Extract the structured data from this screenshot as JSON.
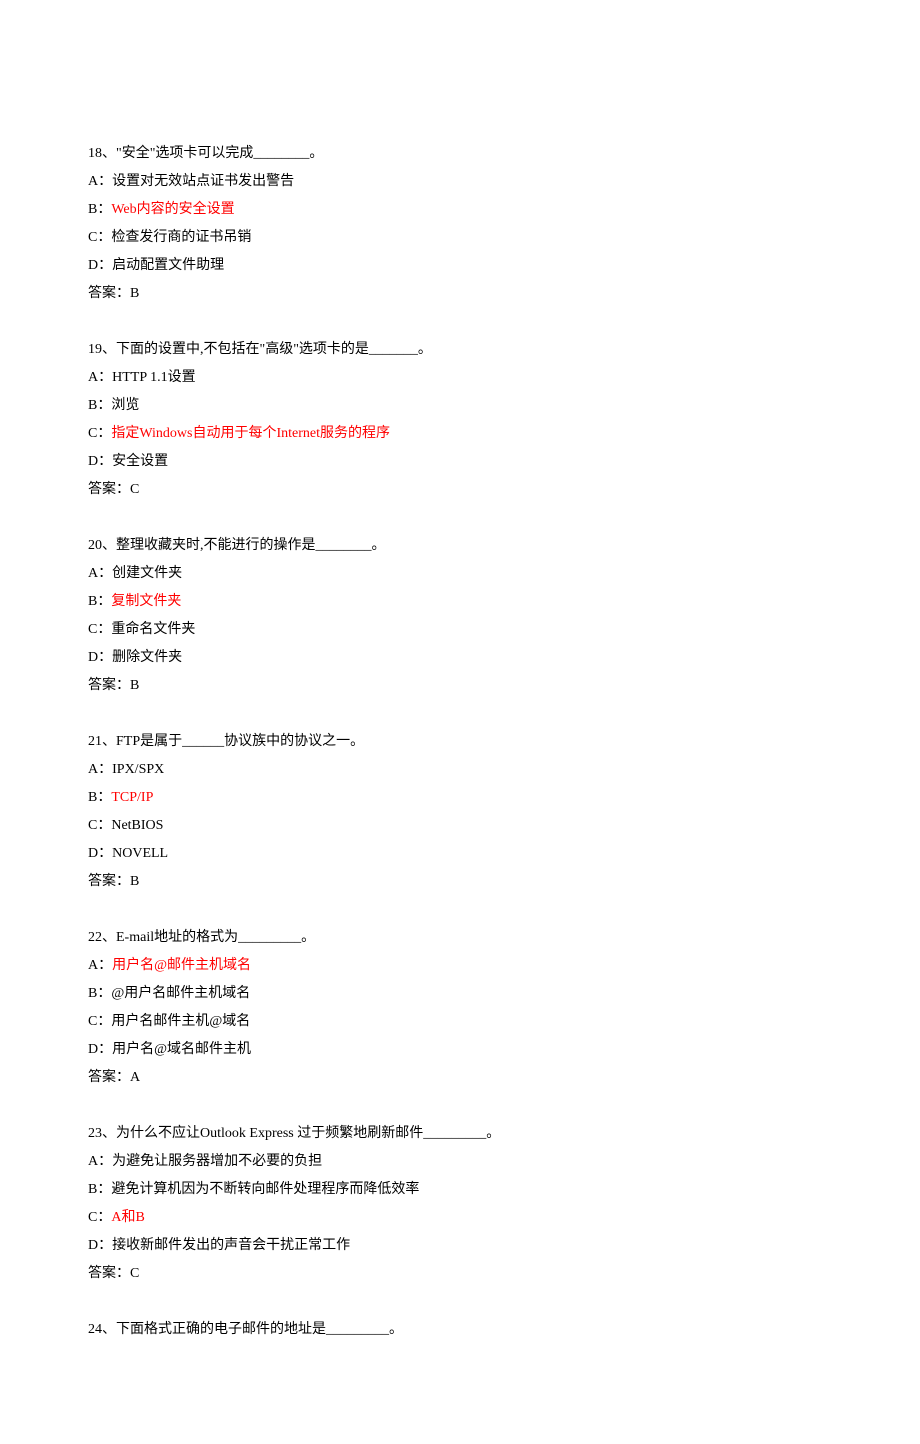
{
  "questions": [
    {
      "id": "q18",
      "stem": "18、\"安全\"选项卡可以完成________。",
      "options": [
        {
          "id": "q18A",
          "label": "A：",
          "text": "设置对无效站点证书发出警告",
          "highlight": false
        },
        {
          "id": "q18B",
          "label": "B：",
          "text": "Web内容的安全设置",
          "highlight": true
        },
        {
          "id": "q18C",
          "label": "C：",
          "text": "检查发行商的证书吊销",
          "highlight": false
        },
        {
          "id": "q18D",
          "label": "D：",
          "text": "启动配置文件助理",
          "highlight": false
        }
      ],
      "answer": "答案：B"
    },
    {
      "id": "q19",
      "stem": "19、下面的设置中,不包括在\"高级\"选项卡的是_______。",
      "options": [
        {
          "id": "q19A",
          "label": "A：",
          "text": "HTTP 1.1设置",
          "highlight": false
        },
        {
          "id": "q19B",
          "label": "B：",
          "text": "浏览",
          "highlight": false
        },
        {
          "id": "q19C",
          "label": "C：",
          "text": "指定Windows自动用于每个Internet服务的程序",
          "highlight": true
        },
        {
          "id": "q19D",
          "label": "D：",
          "text": "安全设置",
          "highlight": false
        }
      ],
      "answer": "答案：C"
    },
    {
      "id": "q20",
      "stem": "20、整理收藏夹时,不能进行的操作是________。",
      "options": [
        {
          "id": "q20A",
          "label": "A：",
          "text": "创建文件夹",
          "highlight": false
        },
        {
          "id": "q20B",
          "label": "B：",
          "text": "复制文件夹",
          "highlight": true
        },
        {
          "id": "q20C",
          "label": "C：",
          "text": "重命名文件夹",
          "highlight": false
        },
        {
          "id": "q20D",
          "label": "D：",
          "text": "删除文件夹",
          "highlight": false
        }
      ],
      "answer": "答案：B"
    },
    {
      "id": "q21",
      "stem": "21、FTP是属于______协议族中的协议之一。",
      "options": [
        {
          "id": "q21A",
          "label": "A：",
          "text": "IPX/SPX",
          "highlight": false
        },
        {
          "id": "q21B",
          "label": "B：",
          "text": "TCP/IP",
          "highlight": true
        },
        {
          "id": "q21C",
          "label": "C：",
          "text": "NetBIOS",
          "highlight": false
        },
        {
          "id": "q21D",
          "label": "D：",
          "text": "NOVELL",
          "highlight": false
        }
      ],
      "answer": "答案：B"
    },
    {
      "id": "q22",
      "stem": "22、E-mail地址的格式为_________。",
      "options": [
        {
          "id": "q22A",
          "label": "A：",
          "text": "用户名@邮件主机域名",
          "highlight": true
        },
        {
          "id": "q22B",
          "label": "B：",
          "text": "@用户名邮件主机域名",
          "highlight": false
        },
        {
          "id": "q22C",
          "label": "C：",
          "text": "用户名邮件主机@域名",
          "highlight": false
        },
        {
          "id": "q22D",
          "label": "D：",
          "text": "用户名@域名邮件主机",
          "highlight": false
        }
      ],
      "answer": "答案：A"
    },
    {
      "id": "q23",
      "stem": "23、为什么不应让Outlook Express 过于频繁地刷新邮件_________。",
      "options": [
        {
          "id": "q23A",
          "label": "A：",
          "text": "为避免让服务器增加不必要的负担",
          "highlight": false
        },
        {
          "id": "q23B",
          "label": "B：",
          "text": "避免计算机因为不断转向邮件处理程序而降低效率",
          "highlight": false
        },
        {
          "id": "q23C",
          "label": "C：",
          "text": "A和B",
          "highlight": true
        },
        {
          "id": "q23D",
          "label": "D：",
          "text": "接收新邮件发出的声音会干扰正常工作",
          "highlight": false
        }
      ],
      "answer": "答案：C"
    },
    {
      "id": "q24",
      "stem": "24、下面格式正确的电子邮件的地址是_________。",
      "options": [],
      "answer": ""
    }
  ]
}
